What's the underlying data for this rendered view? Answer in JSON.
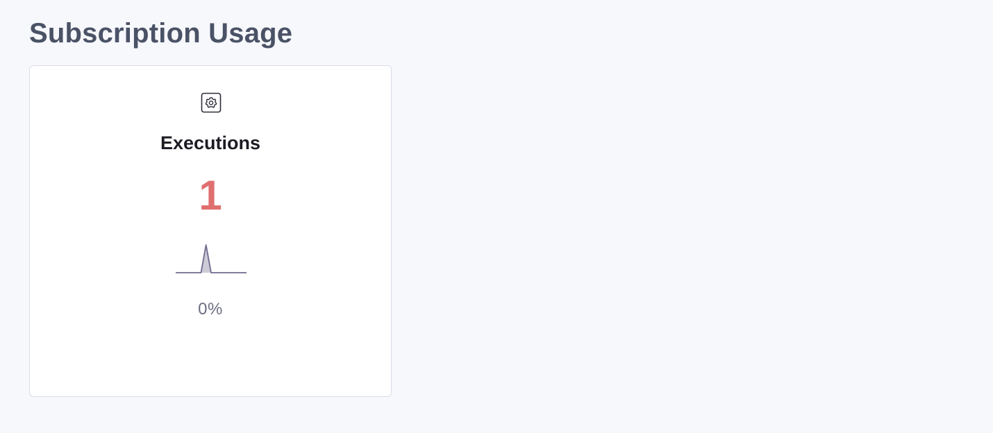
{
  "page": {
    "title": "Subscription Usage"
  },
  "cards": [
    {
      "icon": "gear-icon",
      "title": "Executions",
      "value": "1",
      "percent": "0%",
      "sparkline": [
        0,
        0,
        0,
        0,
        0,
        0,
        1,
        0,
        0,
        0,
        0,
        0,
        0,
        0,
        0
      ]
    }
  ],
  "colors": {
    "background": "#f7f8fc",
    "title": "#4a5266",
    "value": "#e06f6f",
    "sparkline": "#6e6a8c",
    "card_border": "#d9dce8"
  }
}
